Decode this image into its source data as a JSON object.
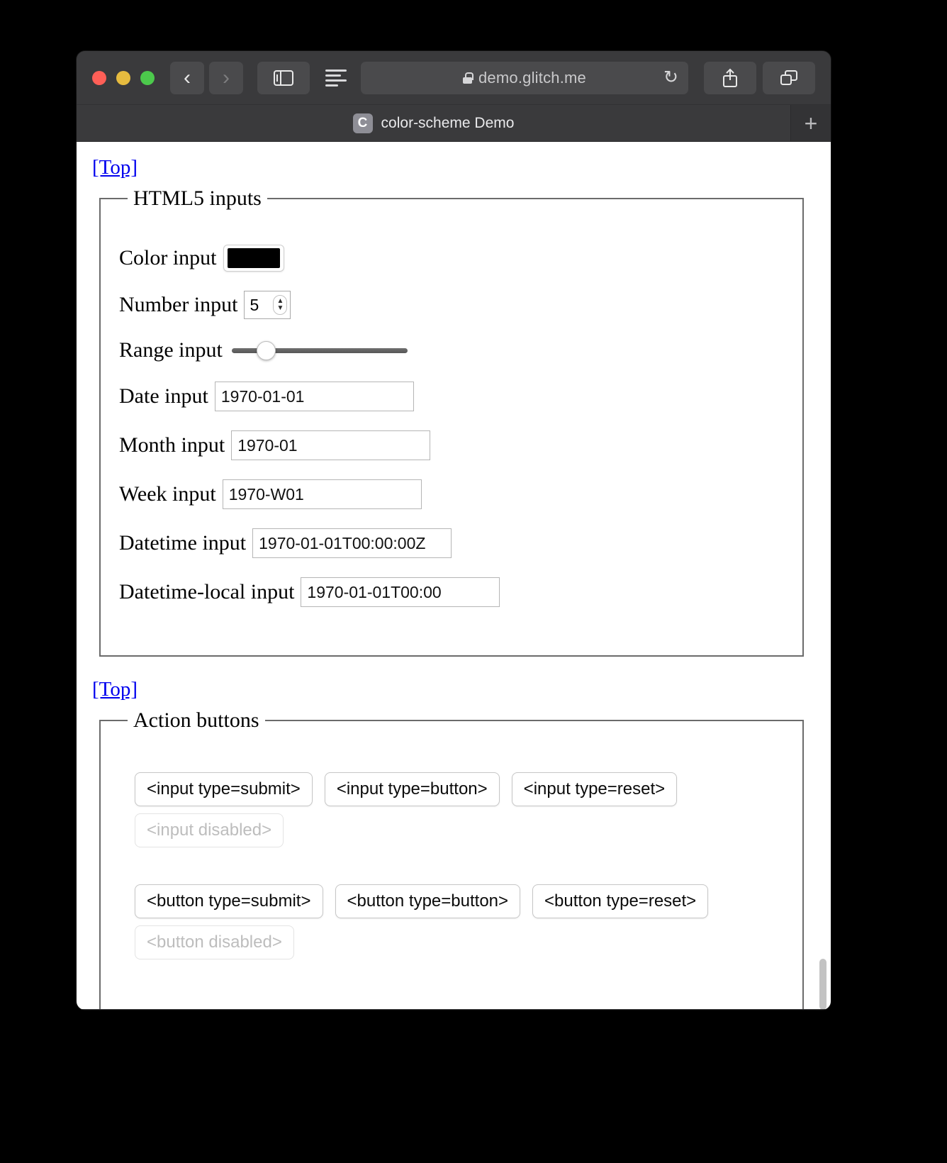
{
  "window": {
    "traffic_lights": [
      "close",
      "minimize",
      "zoom"
    ],
    "toolbar": {
      "back_glyph": "‹",
      "forward_glyph": "›",
      "sidebar_icon": "sidebar-icon",
      "reader_icon": "reader-view-icon",
      "lock_icon": "lock-icon",
      "url": "demo.glitch.me",
      "reload_glyph": "↻",
      "share_icon": "share-icon",
      "tabs_icon": "tab-overview-icon"
    },
    "tab": {
      "favicon_letter": "C",
      "title": "color-scheme Demo",
      "new_tab_glyph": "+"
    }
  },
  "page": {
    "top_link_1": "[Top]",
    "top_link_2": "[Top]",
    "fieldset_inputs": {
      "legend": "HTML5 inputs",
      "rows": [
        {
          "label": "Color input",
          "type": "color",
          "value": "#000000"
        },
        {
          "label": "Number input",
          "type": "number",
          "value": "5"
        },
        {
          "label": "Range input",
          "type": "range",
          "value": "14"
        },
        {
          "label": "Date input",
          "type": "text",
          "value": "1970-01-01"
        },
        {
          "label": "Month input",
          "type": "text",
          "value": "1970-01"
        },
        {
          "label": "Week input",
          "type": "text",
          "value": "1970-W01"
        },
        {
          "label": "Datetime input",
          "type": "text",
          "value": "1970-01-01T00:00:00Z"
        },
        {
          "label": "Datetime-local input",
          "type": "text",
          "value": "1970-01-01T00:00"
        }
      ]
    },
    "fieldset_buttons": {
      "legend": "Action buttons",
      "input_row": [
        {
          "label": "<input type=submit>",
          "disabled": false
        },
        {
          "label": "<input type=button>",
          "disabled": false
        },
        {
          "label": "<input type=reset>",
          "disabled": false
        }
      ],
      "input_disabled": {
        "label": "<input disabled>",
        "disabled": true
      },
      "button_row": [
        {
          "label": "<button type=submit>",
          "disabled": false
        },
        {
          "label": "<button type=button>",
          "disabled": false
        },
        {
          "label": "<button type=reset>",
          "disabled": false
        }
      ],
      "button_disabled": {
        "label": "<button disabled>",
        "disabled": true
      }
    }
  },
  "colors": {
    "link": "#0000ee",
    "toolbar_bg": "#3a3a3c",
    "tabbar_bg": "#333335",
    "page_bg": "#ffffff",
    "color_swatch": "#000000"
  }
}
